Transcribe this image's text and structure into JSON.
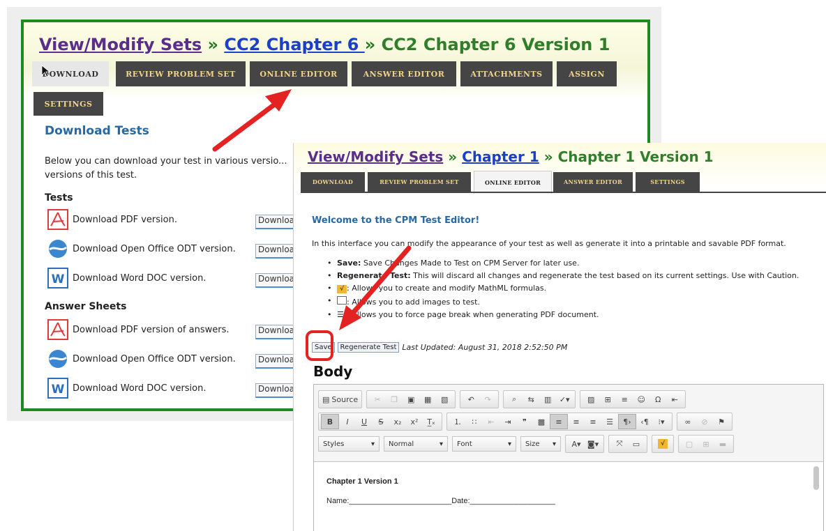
{
  "colors": {
    "accent_green": "#1f8a22",
    "tab_bg": "#454545",
    "tab_text": "#f1d489",
    "heading_blue": "#2868a3",
    "arrow_red": "#e52222"
  },
  "back_window": {
    "breadcrumb": {
      "link1": "View/Modify Sets",
      "sep1": " » ",
      "link2": "CC2 Chapter 6 ",
      "sep2": " » ",
      "current": "CC2 Chapter 6 Version 1"
    },
    "tabs": [
      {
        "label": "DOWNLOAD"
      },
      {
        "label": "REVIEW PROBLEM SET"
      },
      {
        "label": "ONLINE EDITOR"
      },
      {
        "label": "ANSWER EDITOR"
      },
      {
        "label": "ATTACHMENTS"
      },
      {
        "label": "ASSIGN"
      },
      {
        "label": "SETTINGS"
      }
    ],
    "heading": "Download Tests",
    "intro": "Below you can download your test in various versio... versions of this test.",
    "tests_heading": "Tests",
    "tests": [
      {
        "icon": "pdf-icon",
        "label": "Download PDF version.",
        "button": "Downloa"
      },
      {
        "icon": "open-office-icon",
        "label": "Download Open Office ODT version.",
        "button": "Downloa"
      },
      {
        "icon": "word-icon",
        "label": "Download Word DOC version.",
        "button": "Downloa"
      }
    ],
    "answers_heading": "Answer Sheets",
    "answers": [
      {
        "icon": "pdf-icon",
        "label": "Download PDF version of answers.",
        "button": "Downloa"
      },
      {
        "icon": "open-office-icon",
        "label": "Download Open Office ODT version.",
        "button": "Downloa"
      },
      {
        "icon": "word-icon",
        "label": "Download Word DOC version.",
        "button": "Downloa"
      }
    ]
  },
  "front_window": {
    "breadcrumb": {
      "link1": "View/Modify Sets",
      "sep1": " » ",
      "link2": "Chapter 1",
      "sep2": " » ",
      "current": "Chapter 1 Version 1"
    },
    "tabs": [
      {
        "label": "DOWNLOAD"
      },
      {
        "label": "REVIEW PROBLEM SET"
      },
      {
        "label": "ONLINE EDITOR"
      },
      {
        "label": "ANSWER EDITOR"
      },
      {
        "label": "SETTINGS"
      }
    ],
    "welcome": "Welcome to the CPM Test Editor!",
    "intro": "In this interface you can modify the appearance of your test as well as generate it into a printable and savable PDF format.",
    "bullets": [
      {
        "bold": "Save:",
        "text": " Save Changes Made to Test on CPM Server for later use."
      },
      {
        "bold": "Regenerate Test:",
        "text": " This will discard all changes and regenerate the test based on its current settings. Use with Caution."
      },
      {
        "bold": "",
        "text": ": Allows you to create and modify MathML formulas."
      },
      {
        "bold": "",
        "text": ": Allows you to add images to test."
      },
      {
        "bold": "",
        "text": ": Allows you to force page break when generating PDF document."
      }
    ],
    "save_label": "Save",
    "regenerate_label": "Regenerate Test",
    "last_updated": "Last Updated: August 31, 2018 2:52:50 PM",
    "body_label": "Body",
    "toolbar": {
      "source_label": "Source",
      "styles": "Styles",
      "format": "Normal",
      "font": "Font",
      "size": "Size"
    },
    "document": {
      "title": "Chapter 1 Version 1",
      "name_line": "Name:________________________Date:____________________"
    }
  }
}
